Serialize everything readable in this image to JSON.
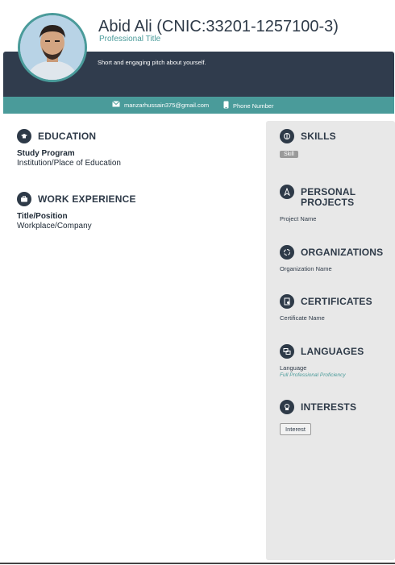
{
  "header": {
    "name": "Abid Ali (CNIC:33201-1257100-3)",
    "title": "Professional Title",
    "pitch": "Short and engaging pitch about yourself."
  },
  "contact": {
    "email": "manzarhussain375@gmail.com",
    "phone": "Phone Number"
  },
  "main": {
    "education": {
      "heading": "EDUCATION",
      "program": "Study Program",
      "institution": "Institution/Place of Education"
    },
    "experience": {
      "heading": "WORK EXPERIENCE",
      "position": "Title/Position",
      "workplace": "Workplace/Company"
    }
  },
  "sidebar": {
    "skills": {
      "heading": "SKILLS",
      "item": "Skill"
    },
    "projects": {
      "heading_line1": "PERSONAL",
      "heading_line2": "PROJECTS",
      "item": "Project Name"
    },
    "organizations": {
      "heading": "ORGANIZATIONS",
      "item": "Organization Name"
    },
    "certificates": {
      "heading": "CERTIFICATES",
      "item": "Certificate Name"
    },
    "languages": {
      "heading": "LANGUAGES",
      "item": "Language",
      "level": "Full Professional Proficiency"
    },
    "interests": {
      "heading": "INTERESTS",
      "item": "Interest"
    }
  },
  "colors": {
    "header": "#303c4d",
    "accent": "#4a9b9a",
    "sidebar": "#e8e8e8"
  },
  "icons": [
    "profile-photo",
    "mail-icon",
    "phone-icon",
    "education-icon",
    "briefcase-icon",
    "skills-icon",
    "projects-icon",
    "organizations-icon",
    "certificate-icon",
    "languages-icon",
    "interests-icon"
  ]
}
